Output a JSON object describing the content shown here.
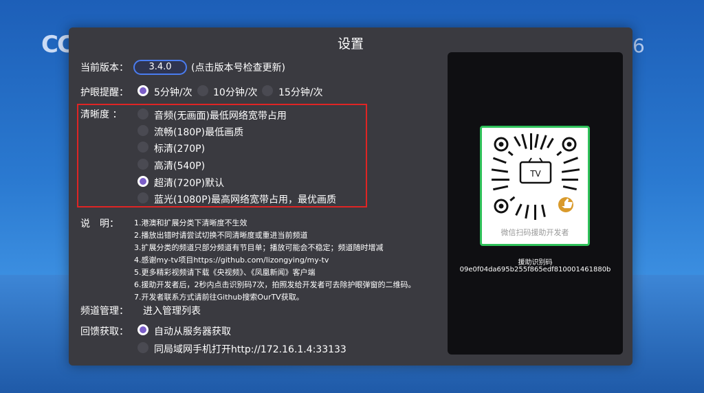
{
  "background": {
    "logo_text": "CC",
    "channel_num": "6"
  },
  "dialog": {
    "title": "设置"
  },
  "version": {
    "label": "当前版本：",
    "value": "3.4.0",
    "hint": "(点击版本号检查更新)"
  },
  "eye_care": {
    "label": "护眼提醒：",
    "options": [
      "5分钟/次",
      "10分钟/次",
      "15分钟/次"
    ],
    "selected_index": 0
  },
  "clarity": {
    "label": "清晰度 ：",
    "options": [
      "音频(无画面)最低网络宽带占用",
      "流畅(180P)最低画质",
      "标清(270P)",
      "高清(540P)",
      "超清(720P)默认",
      "蓝光(1080P)最高网络宽带占用，最优画质"
    ],
    "selected_index": 4
  },
  "notes": {
    "label": "说　明：",
    "lines": [
      "1.港澳和扩展分类下清晰度不生效",
      "2.播放出错时请尝试切换不同清晰度或重进当前频道",
      "3.扩展分类的频道只部分频道有节目单；播放可能会不稳定；频道随时增减",
      "4.感谢my-tv项目https://github.com/lizongying/my-tv",
      "5.更多精彩视频请下载《央视频》、《凤凰新闻》客户端",
      "6.援助开发者后，2秒内点击识别码7次，拍照发给开发者可去除护眼弹窗的二维码。",
      "7.开发者联系方式请前往Github搜索OurTV获取。"
    ]
  },
  "channel_mgmt": {
    "label": "频道管理：",
    "action": "进入管理列表"
  },
  "feedback": {
    "label": "回馈获取：",
    "options": [
      "自动从服务器获取",
      "同局域网手机打开http://172.16.1.4:33133"
    ],
    "selected_index": 0
  },
  "qr": {
    "center_text": "TV",
    "caption": "微信扫码援助开发者",
    "assist_label": "援助识别码",
    "assist_code": "09e0f04da695b255f865edf810001461880b"
  },
  "colors": {
    "accent": "#7b5ec8",
    "pill_border": "#4a7cf0",
    "highlight_box": "#e02424",
    "qr_border": "#2fc15a"
  }
}
